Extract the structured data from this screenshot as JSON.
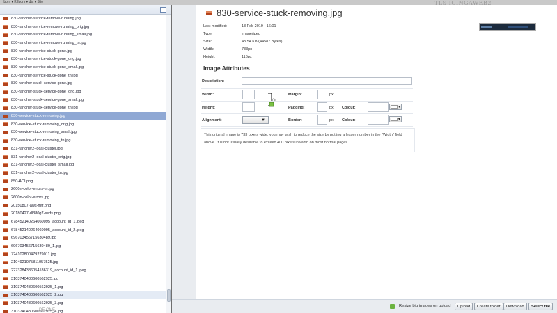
{
  "background": {
    "top_strip": "Ibom   ▾ K   Ibom   ▾ dia   ▾ Site",
    "watermark": "TLS ICINGAWEB2",
    "bottom_text": "DE ONE"
  },
  "file_list": {
    "items": [
      "830-rancher-service-remove-running.jpg",
      "830-rancher-service-remove-running_orig.jpg",
      "830-rancher-service-remove-running_small.jpg",
      "830-rancher-service-remove-running_tn.jpg",
      "830-rancher-service-stuck-gone.jpg",
      "830-rancher-service-stuck-gone_orig.jpg",
      "830-rancher-service-stuck-gone_small.jpg",
      "830-rancher-service-stuck-gone_tn.jpg",
      "830-rancher-stuck-service-gone.jpg",
      "830-rancher-stuck-service-gone_orig.jpg",
      "830-rancher-stuck-service-gone_small.jpg",
      "830-rancher-stuck-service-gone_tn.jpg",
      "830-service-stuck-removing.jpg",
      "830-service-stuck-removing_orig.jpg",
      "830-service-stuck-removing_small.jpg",
      "830-service-stuck-removing_tn.jpg",
      "831-rancher2-local-cluster.jpg",
      "831-rancher2-local-cluster_orig.jpg",
      "831-rancher2-local-cluster_small.jpg",
      "831-rancher2-local-cluster_tn.jpg",
      "850-ACI.png",
      "2600n-color-errors-tn.jpg",
      "2600n-color-errors.jpg",
      "20150807-aws-mtr.png",
      "20180427-dl380g7-ssds.png",
      "678452140264060095_account_id_1.jpeg",
      "678452140264060095_account_id_2.jpeg",
      "696703456715630489.jpg",
      "696703456715630489_1.jpg",
      "724102800479279011.jpg",
      "2104921075811057525.jpg",
      "2273284386054186319_account_id_1.jpeg",
      "3103740480600562925.jpg",
      "3103740480600562925_1.jpg",
      "3103740480600562925_2.jpg",
      "3103740480600562925_3.jpg",
      "3103740480600562925_4.jpg"
    ],
    "selected_index": 12,
    "hover_index": 34
  },
  "details": {
    "file_title": "830-service-stuck-removing.jpg",
    "meta": [
      {
        "label": "Last modified:",
        "value": "13 Feb 2019 - 16:01"
      },
      {
        "label": "Type:",
        "value": "image/jpeg"
      },
      {
        "label": "Size:",
        "value": "43.54 KB (44587 Bytes)"
      },
      {
        "label": "Width:",
        "value": "733px"
      },
      {
        "label": "Height:",
        "value": "116px"
      }
    ]
  },
  "attributes": {
    "heading": "Image Attributes",
    "description_label": "Description:",
    "description_value": "",
    "width_label": "Width:",
    "width_value": "",
    "height_label": "Height:",
    "height_value": "",
    "alignment_label": "Alignment:",
    "alignment_value": "",
    "margin_label": "Margin:",
    "margin_value": "",
    "padding_label": "Padding:",
    "padding_value": "",
    "border_label": "Border:",
    "border_value": "",
    "colour_label": "Colour:",
    "unit": "px",
    "info": "This original image is 733 pixels wide, you may wish to reduce the size by putting a lesser number in the \"Width\" field above. It is not usually desirable to exceed 400 pixels in width on most normal pages."
  },
  "footer": {
    "resize_label": "Resize big images on upload",
    "resize_checked": true,
    "upload": "Upload",
    "create_folder": "Create folder",
    "download": "Download",
    "select_file": "Select file"
  },
  "colors": {
    "selected_row": "#8fa8d4",
    "file_icon": "#b4441c",
    "checkbox_green": "#6cb33f"
  }
}
